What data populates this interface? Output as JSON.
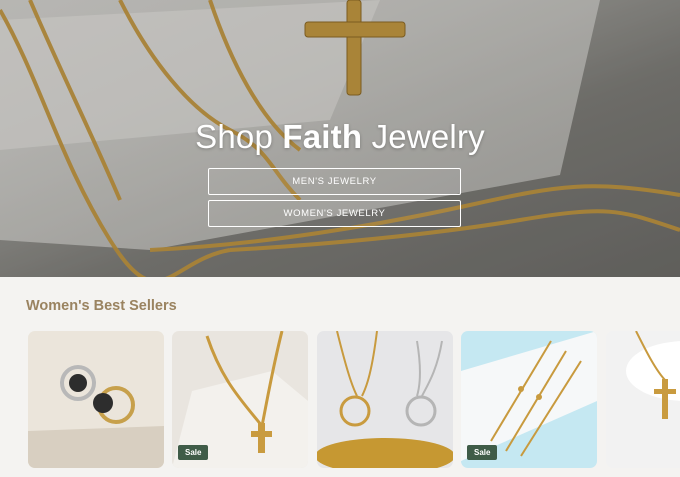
{
  "hero": {
    "title_prefix": "Shop ",
    "title_bold": "Faith",
    "title_suffix": " Jewelry",
    "buttons": [
      {
        "label": "MEN'S JEWELRY"
      },
      {
        "label": "WOMEN'S JEWELRY"
      }
    ]
  },
  "best_sellers": {
    "title": "Women's Best Sellers",
    "products": [
      {
        "image": "rings-product-image",
        "badge": ""
      },
      {
        "image": "cross-necklace-product-image",
        "badge": "Sale"
      },
      {
        "image": "mountain-pendant-product-image",
        "badge": ""
      },
      {
        "image": "layered-necklace-product-image",
        "badge": "Sale"
      },
      {
        "image": "cross-pendant-product-image",
        "badge": ""
      }
    ]
  },
  "colors": {
    "section_title": "#9a8360",
    "sale_badge": "#3f5c48",
    "page_background": "#f4f3f1"
  }
}
